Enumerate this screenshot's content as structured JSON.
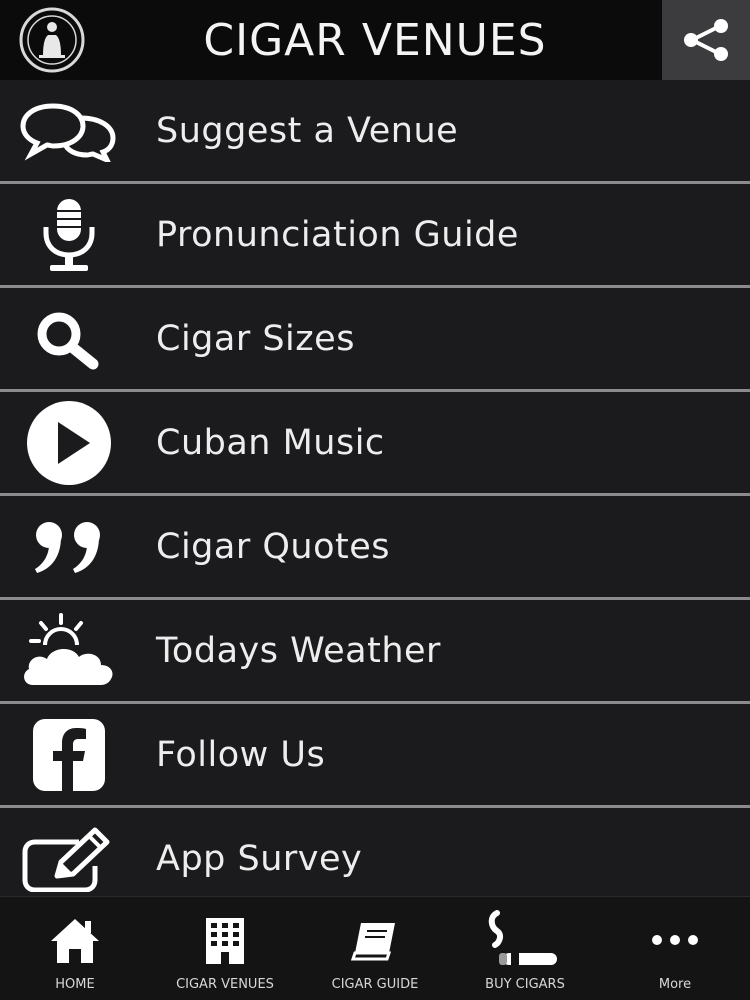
{
  "header": {
    "title": "CIGAR VENUES",
    "logo_icon": "cigar-brand-logo-icon",
    "share_icon": "share-icon"
  },
  "menu": {
    "items": [
      {
        "label": "Suggest a Venue",
        "icon": "speech-bubbles-icon"
      },
      {
        "label": "Pronunciation Guide",
        "icon": "microphone-icon"
      },
      {
        "label": "Cigar Sizes",
        "icon": "magnifier-icon"
      },
      {
        "label": "Cuban Music",
        "icon": "play-icon"
      },
      {
        "label": "Cigar Quotes",
        "icon": "quote-icon"
      },
      {
        "label": "Todays Weather",
        "icon": "weather-icon"
      },
      {
        "label": "Follow Us",
        "icon": "facebook-icon"
      },
      {
        "label": "App Survey",
        "icon": "edit-icon"
      }
    ]
  },
  "tabbar": {
    "tabs": [
      {
        "label": "HOME",
        "icon": "home-icon"
      },
      {
        "label": "CIGAR VENUES",
        "icon": "building-icon"
      },
      {
        "label": "CIGAR GUIDE",
        "icon": "book-icon"
      },
      {
        "label": "BUY CIGARS",
        "icon": "cigar-icon"
      },
      {
        "label": "More",
        "icon": "more-icon"
      }
    ]
  },
  "colors": {
    "background": "#1b1a1c",
    "header_bg": "#0b0b0c",
    "share_bg": "#3c3c3e",
    "divider": "#8c8c8e",
    "text": "#ededed"
  }
}
